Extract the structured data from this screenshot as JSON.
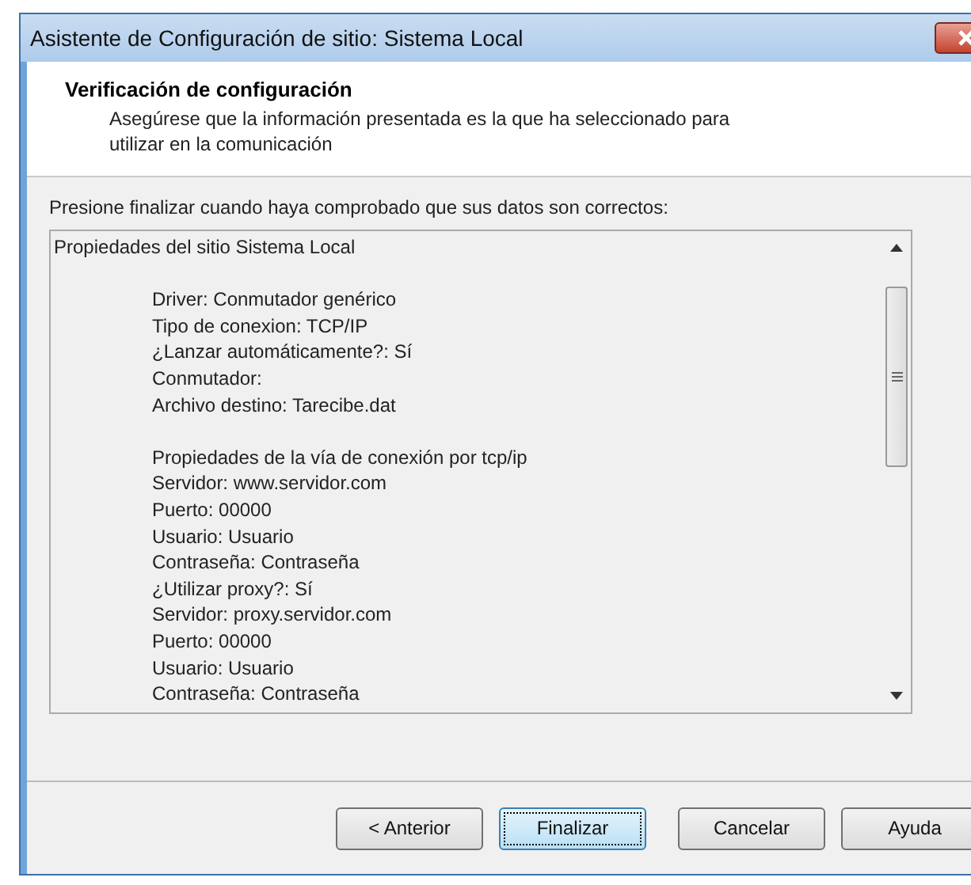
{
  "window": {
    "title": "Asistente de Configuración de sitio: Sistema Local"
  },
  "header": {
    "title": "Verificación de configuración",
    "description": "Asegúrese que la información presentada es la que ha seleccionado para utilizar en la comunicación"
  },
  "instruction": "Presione finalizar cuando haya comprobado que sus datos son correctos:",
  "listing": {
    "title": "Propiedades del sitio Sistema Local",
    "sections": [
      [
        "Driver: Conmutador genérico",
        "Tipo de conexion: TCP/IP",
        "¿Lanzar automáticamente?: Sí",
        "Conmutador:",
        "Archivo destino: Tarecibe.dat"
      ],
      [
        "Propiedades de la vía de conexión por tcp/ip",
        "Servidor: www.servidor.com",
        "Puerto: 00000",
        "Usuario: Usuario",
        "Contraseña: Contraseña",
        "¿Utilizar proxy?: Sí",
        "Servidor: proxy.servidor.com",
        "Puerto: 00000",
        "Usuario: Usuario",
        "Contraseña: Contraseña"
      ]
    ]
  },
  "buttons": [
    {
      "label": "< Anterior",
      "default": false
    },
    {
      "label": "Finalizar",
      "default": true
    },
    {
      "label": "Cancelar",
      "default": false
    },
    {
      "label": "Ayuda",
      "default": false
    }
  ]
}
